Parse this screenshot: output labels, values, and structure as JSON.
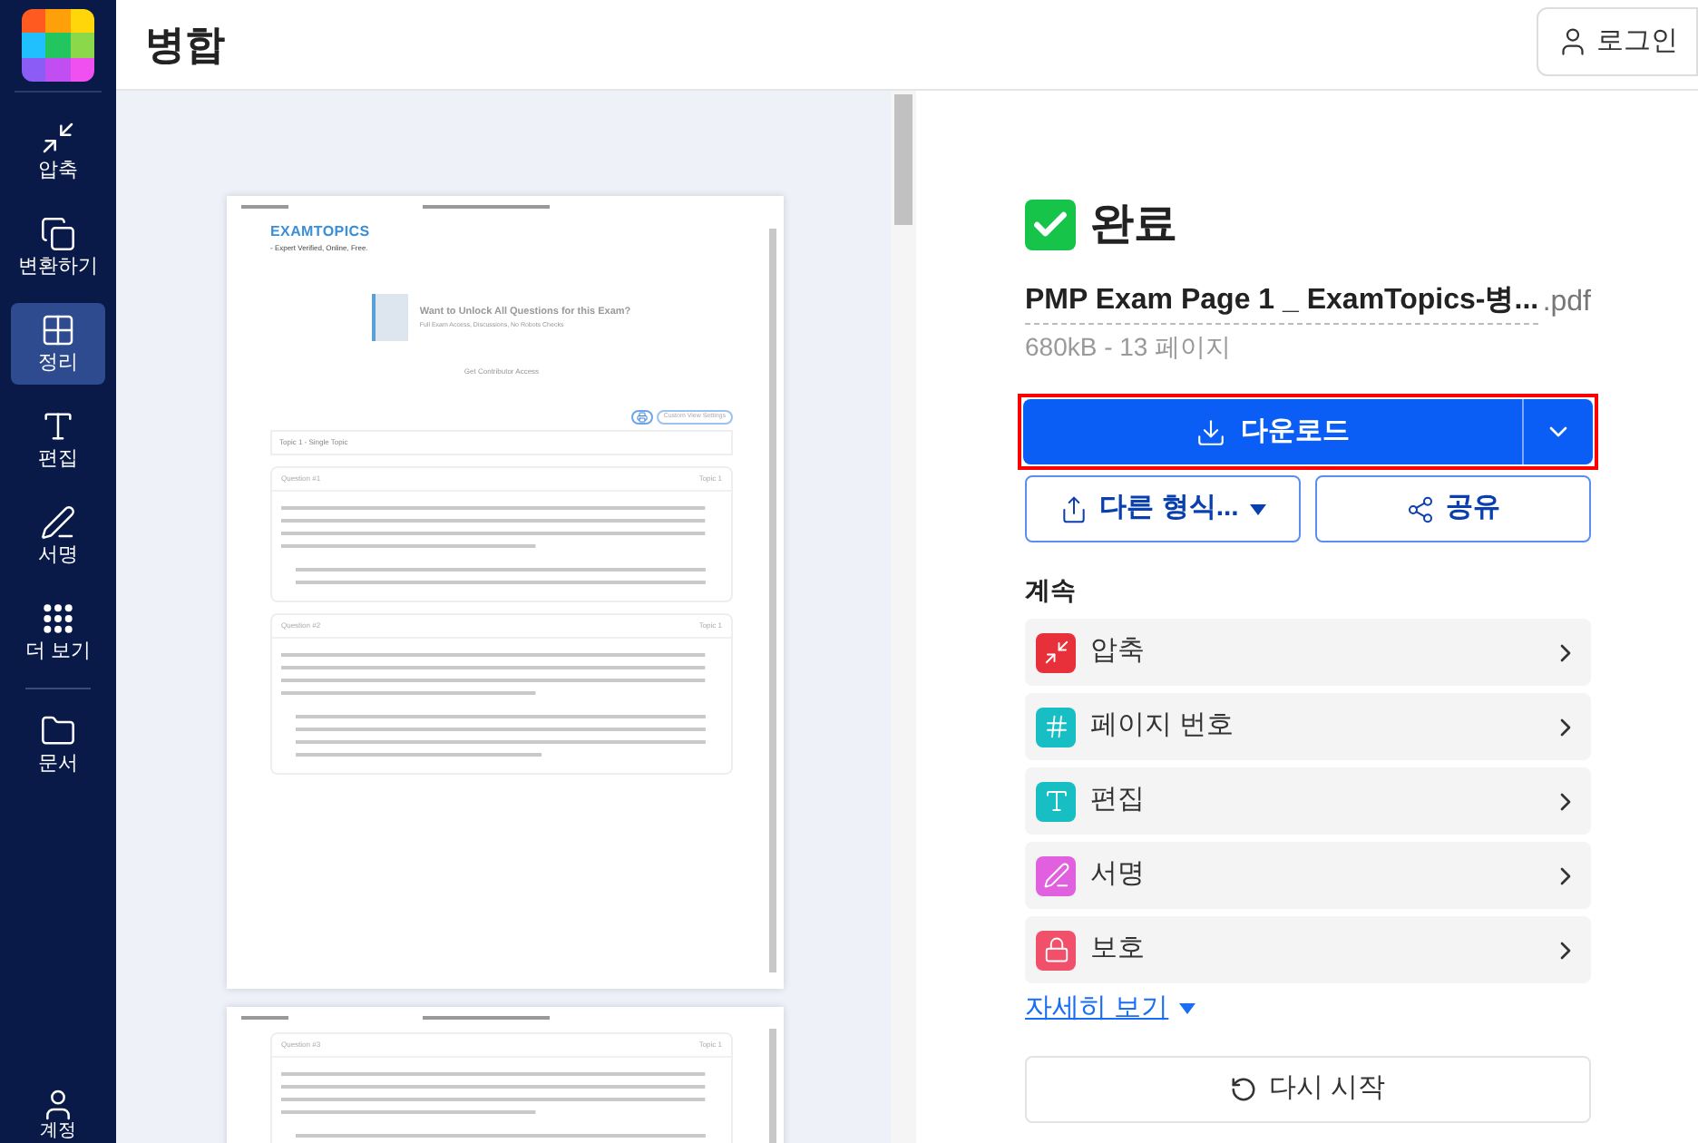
{
  "sidebar": {
    "items": [
      {
        "label": "압축",
        "selected": false
      },
      {
        "label": "변환하기",
        "selected": false
      },
      {
        "label": "정리",
        "selected": true
      },
      {
        "label": "편집",
        "selected": false
      },
      {
        "label": "서명",
        "selected": false
      },
      {
        "label": "더 보기",
        "selected": false
      },
      {
        "label": "문서",
        "selected": false
      }
    ],
    "account": "계정"
  },
  "header": {
    "title": "병합",
    "login": "로그인"
  },
  "preview": {
    "pages": [
      {
        "logo": "EXAMTOPICS",
        "tagline": "- Expert Verified, Online, Free.",
        "promo_title": "Want to Unlock All Questions for this Exam?",
        "promo_subtitle": "Full Exam Access, Discussions, No Robots Checks",
        "promo_button": "Get Contributor Access",
        "custom_view": "Custom View Settings",
        "topic": "Topic 1 - Single Topic",
        "questions": [
          {
            "number": "Question #1",
            "topic": "Topic 1"
          },
          {
            "number": "Question #2",
            "topic": "Topic 1"
          }
        ]
      },
      {
        "questions": [
          {
            "number": "Question #3",
            "topic": "Topic 1"
          }
        ]
      }
    ]
  },
  "result": {
    "status": "완료",
    "file_name": "PMP Exam Page 1 _ ExamTopics-병...",
    "extension": ".pdf",
    "meta": "680kB - 13 페이지",
    "download": "다운로드",
    "other_format": "다른 형식...",
    "share": "공유",
    "continue_title": "계속",
    "continue_items": [
      {
        "label": "압축",
        "color": "#e8303a"
      },
      {
        "label": "페이지 번호",
        "color": "#17bfc4"
      },
      {
        "label": "편집",
        "color": "#17bfc4"
      },
      {
        "label": "서명",
        "color": "#e060e0"
      },
      {
        "label": "보호",
        "color": "#f0506a"
      }
    ],
    "more_link": "자세히 보기",
    "restart": "다시 시작"
  }
}
